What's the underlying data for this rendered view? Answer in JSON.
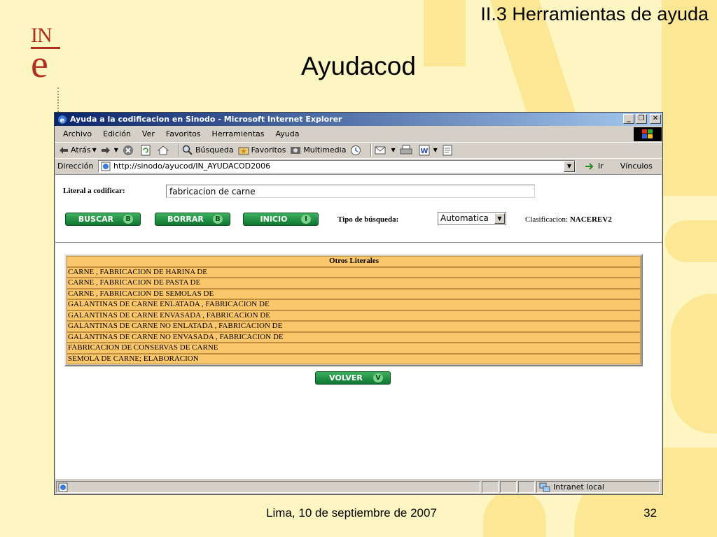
{
  "slide": {
    "section": "II.3 Herramientas de ayuda",
    "title": "Ayudacod",
    "footer_date": "Lima, 10 de septiembre de 2007",
    "page_number": "32",
    "logo_text": "INe"
  },
  "browser": {
    "window_title": "Ayuda a la codificacion en Sinodo - Microsoft Internet Explorer",
    "window_buttons": [
      "_",
      "❐",
      "✕"
    ],
    "menu": [
      "Archivo",
      "Edición",
      "Ver",
      "Favoritos",
      "Herramientas",
      "Ayuda"
    ],
    "toolbar": {
      "back": "Atrás",
      "search": "Búsqueda",
      "favorites": "Favoritos",
      "multimedia": "Multimedia"
    },
    "address_label": "Dirección",
    "url": "http://sinodo/ayucod/IN_AYUDACOD2006",
    "go_label": "Ir",
    "links_label": "Vínculos",
    "status_zone": "Intranet local"
  },
  "form": {
    "literal_label": "Literal a codificar:",
    "literal_value": "fabricacion de carne",
    "buttons": {
      "buscar": {
        "label": "BUSCAR",
        "key": "B"
      },
      "borrar": {
        "label": "BORRAR",
        "key": "B"
      },
      "inicio": {
        "label": "INICIO",
        "key": "I"
      },
      "volver": {
        "label": "VOLVER",
        "key": "V"
      }
    },
    "tipo_label": "Tipo de búsqueda:",
    "tipo_value": "Automatica",
    "clasificacion_label": "Clasificacion:",
    "clasificacion_value": "NACEREV2"
  },
  "results": {
    "header": "Otros Literales",
    "rows": [
      "CARNE , FABRICACION DE HARINA DE",
      "CARNE , FABRICACION DE PASTA DE",
      "CARNE , FABRICACION DE SEMOLAS DE",
      "GALANTINAS DE CARNE ENLATADA , FABRICACION DE",
      "GALANTINAS DE CARNE ENVASADA , FABRICACION DE",
      "GALANTINAS DE CARNE NO ENLATADA , FABRICACION DE",
      "GALANTINAS DE CARNE NO ENVASADA , FABRICACION DE",
      "FABRICACION DE CONSERVAS DE CARNE",
      "SEMOLA DE CARNE; ELABORACION"
    ]
  },
  "colors": {
    "slide_background": "#fdf6c2",
    "watermark": "#fce795",
    "logo": "#b03020",
    "table_row": "#fcc66a",
    "button_green": "#107530",
    "titlebar": "#0a246a"
  }
}
